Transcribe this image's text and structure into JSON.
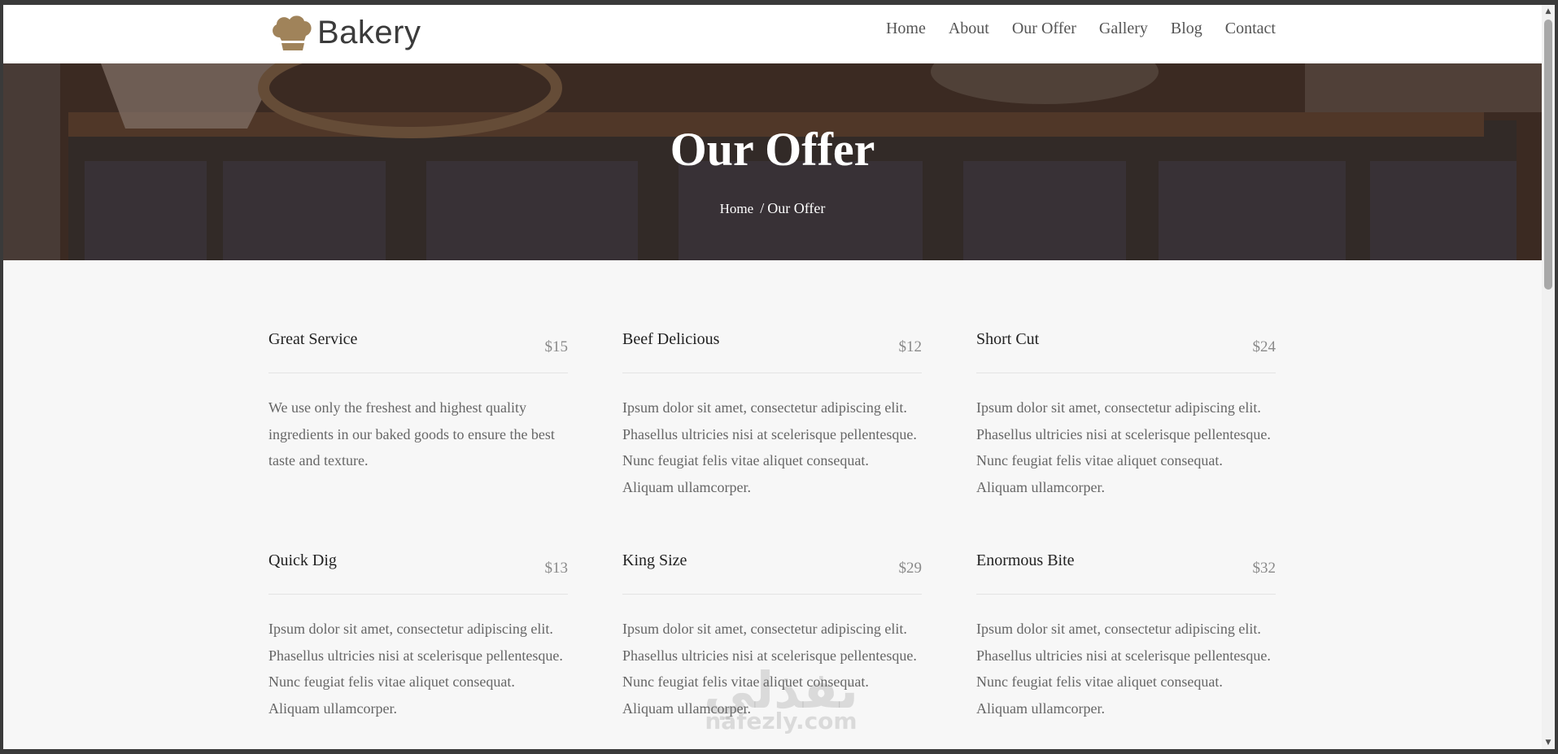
{
  "brand": {
    "name": "Bakery",
    "icon": "chef-hat-icon",
    "accent": "#a0835a"
  },
  "nav": [
    "Home",
    "About",
    "Our Offer",
    "Gallery",
    "Blog",
    "Contact"
  ],
  "hero": {
    "title": "Our Offer",
    "breadcrumb": {
      "home": "Home",
      "separator": "/",
      "current": "Our Offer"
    }
  },
  "offers": [
    {
      "name": "Great Service",
      "price": "$15",
      "desc": "We use only the freshest and highest quality ingredients in our baked goods to ensure the best taste and texture."
    },
    {
      "name": "Beef Delicious",
      "price": "$12",
      "desc": "Ipsum dolor sit amet, consectetur adipiscing elit. Phasellus ultricies nisi at scelerisque pellentesque. Nunc feugiat felis vitae aliquet consequat. Aliquam ullamcorper."
    },
    {
      "name": "Short Cut",
      "price": "$24",
      "desc": "Ipsum dolor sit amet, consectetur adipiscing elit. Phasellus ultricies nisi at scelerisque pellentesque. Nunc feugiat felis vitae aliquet consequat. Aliquam ullamcorper."
    },
    {
      "name": "Quick Dig",
      "price": "$13",
      "desc": "Ipsum dolor sit amet, consectetur adipiscing elit. Phasellus ultricies nisi at scelerisque pellentesque. Nunc feugiat felis vitae aliquet consequat. Aliquam ullamcorper."
    },
    {
      "name": "King Size",
      "price": "$29",
      "desc": "Ipsum dolor sit amet, consectetur adipiscing elit. Phasellus ultricies nisi at scelerisque pellentesque. Nunc feugiat felis vitae aliquet consequat. Aliquam ullamcorper."
    },
    {
      "name": "Enormous Bite",
      "price": "$32",
      "desc": "Ipsum dolor sit amet, consectetur adipiscing elit. Phasellus ultricies nisi at scelerisque pellentesque. Nunc feugiat felis vitae aliquet consequat. Aliquam ullamcorper."
    }
  ],
  "watermark": {
    "arabic": "نفذلي",
    "latin": "nafezly.com"
  }
}
